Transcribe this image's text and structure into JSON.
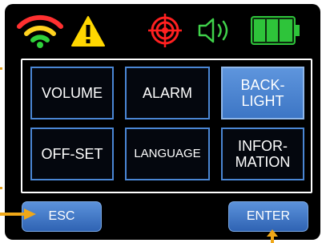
{
  "status_bar": {
    "icons": [
      "wifi-signal-icon",
      "warning-icon",
      "target-icon",
      "speaker-volume-icon",
      "battery-full-icon"
    ],
    "colors": {
      "wifi_bars": [
        "#ff3030",
        "#ffd21f",
        "#2fd13a"
      ],
      "warning": "#ffd700",
      "target": "#ff2020",
      "speaker": "#3fd14a",
      "battery": "#2ec43a"
    }
  },
  "menu": {
    "buttons": [
      {
        "label": "VOLUME",
        "active": false
      },
      {
        "label": "ALARM",
        "active": false
      },
      {
        "label": "BACK-\nLIGHT",
        "active": true
      },
      {
        "label": "OFF-SET",
        "active": false
      },
      {
        "label": "LANGUAGE",
        "active": false
      },
      {
        "label": "INFOR-\nMATION",
        "active": false
      }
    ]
  },
  "softkeys": {
    "esc_label": "ESC",
    "enter_label": "ENTER"
  },
  "colors": {
    "accent": "#4a86d4",
    "pointer_arrow": "#f0a818",
    "screen_background": "#000000"
  }
}
